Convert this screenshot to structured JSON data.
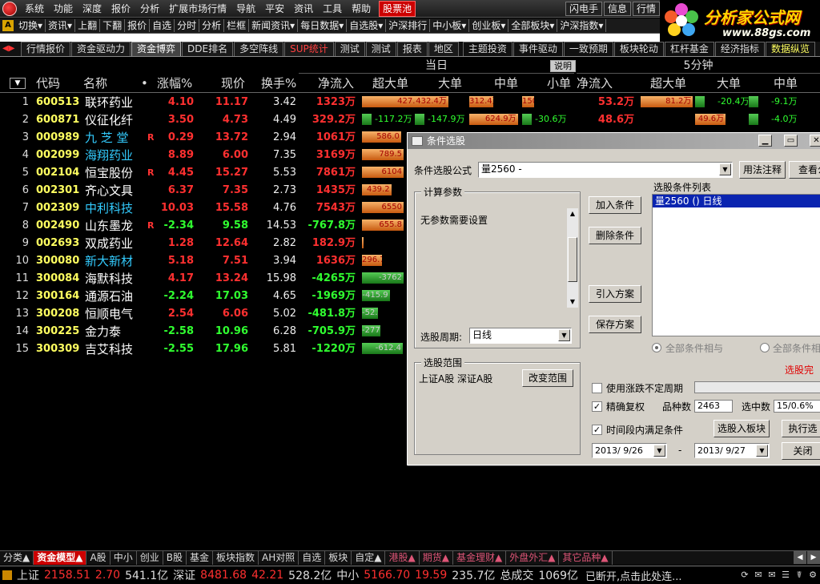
{
  "menubar": {
    "items": [
      "系统",
      "功能",
      "深度",
      "报价",
      "分析",
      "扩展市场行情",
      "导航",
      "平安",
      "资讯",
      "工具",
      "帮助"
    ],
    "highlight": "股票池",
    "right": [
      "闪电手",
      "信息",
      "行情"
    ]
  },
  "brand": {
    "name": "分析家公式网",
    "url": "www.88gs.com"
  },
  "toolbar": {
    "items": [
      "切换▾",
      "资讯▾",
      "上翻",
      "下翻",
      "报价",
      "自选",
      "分时",
      "分析",
      "栏框",
      "新闻资讯▾",
      "每日数据▾",
      "自选股▾",
      "沪深排行",
      "中小板▾",
      "创业板▾",
      "全部板块▾",
      "沪深指数▾"
    ]
  },
  "tabs": {
    "left": [
      "行情报价",
      "资金驱动力",
      "资金博弈",
      "DDE排名",
      "多空阵线",
      "SUP统计",
      "测试",
      "测试",
      "报表",
      "地区"
    ],
    "active": "资金博弈",
    "right": [
      "主题投资",
      "事件驱动",
      "一致预期",
      "板块轮动",
      "杠杆基金",
      "经济指标",
      "数据纵览"
    ]
  },
  "grid": {
    "group_day": "当日",
    "group_5min": "5分钟",
    "explain": "说明",
    "headers": [
      "代码",
      "名称",
      "•",
      "涨幅%",
      "现价",
      "换手%",
      "净流入",
      "超大单",
      "大单",
      "中单",
      "小单",
      "净流入",
      "超大单",
      "大单",
      "中单"
    ],
    "rows": [
      {
        "n": "1",
        "code": "600513",
        "name": "联环药业",
        "blue": false,
        "r": "",
        "chg": "4.10",
        "price": "11.17",
        "turn": "3.42",
        "flow": "1323万",
        "d": [
          "427.2万",
          "432.4万",
          "312.4万",
          "150.6万"
        ],
        "dv": [
          427.2,
          432.4,
          312.4,
          150.6
        ],
        "m_flow": "53.2万",
        "m": [
          "81.2万",
          "-20.4万",
          "-9.1万"
        ],
        "mv": [
          81.2,
          -20.4,
          -9.1
        ]
      },
      {
        "n": "2",
        "code": "600871",
        "name": "仪征化纤",
        "blue": false,
        "r": "",
        "chg": "3.50",
        "price": "4.73",
        "turn": "4.49",
        "flow": "329.2万",
        "d": [
          "-117.2万",
          "-147.9万",
          "624.9万",
          "-30.6万"
        ],
        "dv": [
          -117.2,
          -147.9,
          624.9,
          -30.6
        ],
        "m_flow": "48.6万",
        "m": [
          "",
          "49.6万",
          "-4.0万"
        ],
        "mv": [
          0,
          49.6,
          -4.0
        ]
      },
      {
        "n": "3",
        "code": "000989",
        "name": "九 芝 堂",
        "blue": true,
        "r": "R",
        "chg": "0.29",
        "price": "13.72",
        "turn": "2.94",
        "flow": "1061万",
        "d": [
          "586.0"
        ],
        "dv": [
          586.0
        ],
        "m_flow": "",
        "m": [],
        "mv": []
      },
      {
        "n": "4",
        "code": "002099",
        "name": "海翔药业",
        "blue": true,
        "r": "",
        "chg": "8.89",
        "price": "6.00",
        "turn": "7.35",
        "flow": "3169万",
        "d": [
          "789.5"
        ],
        "dv": [
          789.5
        ],
        "m_flow": "",
        "m": [],
        "mv": []
      },
      {
        "n": "5",
        "code": "002104",
        "name": "恒宝股份",
        "blue": false,
        "r": "R",
        "chg": "4.45",
        "price": "15.27",
        "turn": "5.53",
        "flow": "7861万",
        "d": [
          "6104"
        ],
        "dv": [
          6104
        ],
        "m_flow": "",
        "m": [],
        "mv": []
      },
      {
        "n": "6",
        "code": "002301",
        "name": "齐心文具",
        "blue": false,
        "r": "",
        "chg": "6.37",
        "price": "7.35",
        "turn": "2.73",
        "flow": "1435万",
        "d": [
          "439.2"
        ],
        "dv": [
          439.2
        ],
        "m_flow": "",
        "m": [],
        "mv": []
      },
      {
        "n": "7",
        "code": "002309",
        "name": "中利科技",
        "blue": true,
        "r": "",
        "chg": "10.03",
        "price": "15.58",
        "turn": "4.76",
        "flow": "7543万",
        "d": [
          "6550"
        ],
        "dv": [
          6550
        ],
        "m_flow": "",
        "m": [],
        "mv": []
      },
      {
        "n": "8",
        "code": "002490",
        "name": "山东墨龙",
        "blue": false,
        "r": "R",
        "chg": "-2.34",
        "price": "9.58",
        "turn": "14.53",
        "flow": "-767.8万",
        "d": [
          "655.8"
        ],
        "dv": [
          655.8
        ],
        "m_flow": "",
        "m": [],
        "mv": []
      },
      {
        "n": "9",
        "code": "002693",
        "name": "双成药业",
        "blue": false,
        "r": "",
        "chg": "1.28",
        "price": "12.64",
        "turn": "2.82",
        "flow": "182.9万",
        "d": [
          ""
        ],
        "dv": [
          2
        ],
        "m_flow": "",
        "m": [],
        "mv": []
      },
      {
        "n": "10",
        "code": "300080",
        "name": "新大新材",
        "blue": true,
        "r": "",
        "chg": "5.18",
        "price": "7.51",
        "turn": "3.94",
        "flow": "1636万",
        "d": [
          "296.7"
        ],
        "dv": [
          296.7
        ],
        "m_flow": "",
        "m": [],
        "mv": []
      },
      {
        "n": "11",
        "code": "300084",
        "name": "海默科技",
        "blue": false,
        "r": "",
        "chg": "4.17",
        "price": "13.24",
        "turn": "15.98",
        "flow": "-4265万",
        "d": [
          "-3762"
        ],
        "dv": [
          -3762
        ],
        "m_flow": "",
        "m": [],
        "mv": []
      },
      {
        "n": "12",
        "code": "300164",
        "name": "通源石油",
        "blue": false,
        "r": "",
        "chg": "-2.24",
        "price": "17.03",
        "turn": "4.65",
        "flow": "-1969万",
        "d": [
          "-415.9"
        ],
        "dv": [
          -415.9
        ],
        "m_flow": "",
        "m": [],
        "mv": []
      },
      {
        "n": "13",
        "code": "300208",
        "name": "恒顺电气",
        "blue": false,
        "r": "",
        "chg": "2.54",
        "price": "6.06",
        "turn": "5.02",
        "flow": "-481.8万",
        "d": [
          "-52.07"
        ],
        "dv": [
          -52.07
        ],
        "m_flow": "",
        "m": [],
        "mv": []
      },
      {
        "n": "14",
        "code": "300225",
        "name": "金力泰",
        "blue": false,
        "r": "",
        "chg": "-2.58",
        "price": "10.96",
        "turn": "6.28",
        "flow": "-705.9万",
        "d": [
          "-277.7"
        ],
        "dv": [
          -277.7
        ],
        "m_flow": "",
        "m": [],
        "mv": []
      },
      {
        "n": "15",
        "code": "300309",
        "name": "吉艾科技",
        "blue": false,
        "r": "",
        "chg": "-2.55",
        "price": "17.96",
        "turn": "5.81",
        "flow": "-1220万",
        "d": [
          "-612.4"
        ],
        "dv": [
          -612.4
        ],
        "m_flow": "",
        "m": [],
        "mv": []
      }
    ]
  },
  "dialog": {
    "title": "条件选股",
    "formula_label": "条件选股公式",
    "formula_value": "量2560  -",
    "usage_btn": "用法注释",
    "view_btn": "查看公",
    "params_title": "计算参数",
    "params_text": "无参数需要设置",
    "period_label": "选股周期:",
    "period_value": "日线",
    "range_title": "选股范围",
    "range_text": "上证A股 深证A股",
    "change_range_btn": "改变范围",
    "add_btn": "加入条件",
    "del_btn": "删除条件",
    "import_btn": "引入方案",
    "save_btn": "保存方案",
    "list_title": "选股条件列表",
    "list_item": "量2560  () 日线",
    "radio_and": "全部条件相与",
    "radio_or": "全部条件相",
    "done_text": "选股完",
    "uncertain_label": "使用涨跌不定周期",
    "exact_label": "精确复权",
    "count_label": "品种数",
    "count_value": "2463",
    "selected_label": "选中数",
    "selected_value": "15/0.6%",
    "timerange_label": "时间段内满足条件",
    "to_block_btn": "选股入板块",
    "run_btn": "执行选",
    "date_from": "2013/ 9/26",
    "date_sep": "-",
    "date_to": "2013/ 9/27",
    "close_btn": "关闭"
  },
  "bottom_tabs": {
    "items": [
      "分类▲",
      "资金模型▲",
      "A股",
      "中小",
      "创业",
      "B股",
      "基金",
      "板块指数",
      "AH对照",
      "自选",
      "板块",
      "自定▲",
      "港股▲",
      "期货▲",
      "基金理财▲",
      "外盘外汇▲",
      "其它品种▲"
    ],
    "active": "资金模型▲"
  },
  "status": {
    "sh_label": "上证",
    "sh_val": "2158.51",
    "sh_chg": "2.70",
    "sh_amt": "541.1亿",
    "sz_label": "深证",
    "sz_val": "8481.68",
    "sz_chg": "42.21",
    "sz_amt": "528.2亿",
    "zx_label": "中小",
    "zx_val": "5166.70",
    "zx_chg": "19.59",
    "zx_amt": "235.7亿",
    "total_label": "总成交",
    "total_val": "1069亿",
    "msg": "已断开,点击此处连..."
  },
  "colors": {
    "up": "#ff3030",
    "down": "#30ff30",
    "code": "#ffff60",
    "bar_pos": "#e07a2a",
    "bar_neg": "#2a9a2a"
  }
}
